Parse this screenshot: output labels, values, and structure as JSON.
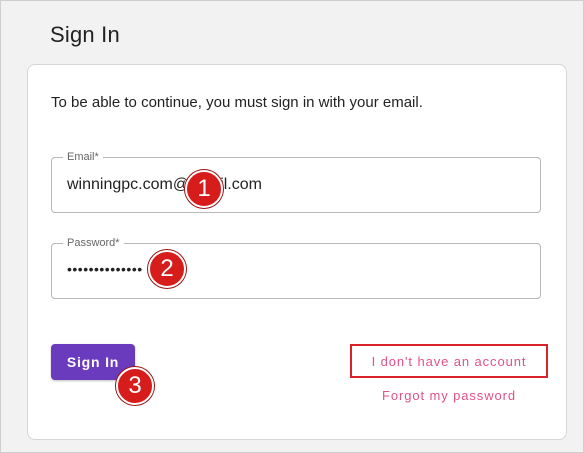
{
  "header": {
    "title": "Sign In"
  },
  "card": {
    "intro": "To be able to continue, you must sign in with your email."
  },
  "email": {
    "label": "Email*",
    "value": "winningpc.com@gmail.com"
  },
  "password": {
    "label": "Password*",
    "value": "••••••••••••••"
  },
  "actions": {
    "signin_label": "Sign In",
    "no_account_label": "I don't have an account",
    "forgot_label": "Forgot my password"
  },
  "markers": [
    "1",
    "2",
    "3"
  ],
  "colors": {
    "primary": "#6a3bbd",
    "link": "#e0528a",
    "highlight_border": "#d8232a",
    "marker": "#d71c1c"
  }
}
